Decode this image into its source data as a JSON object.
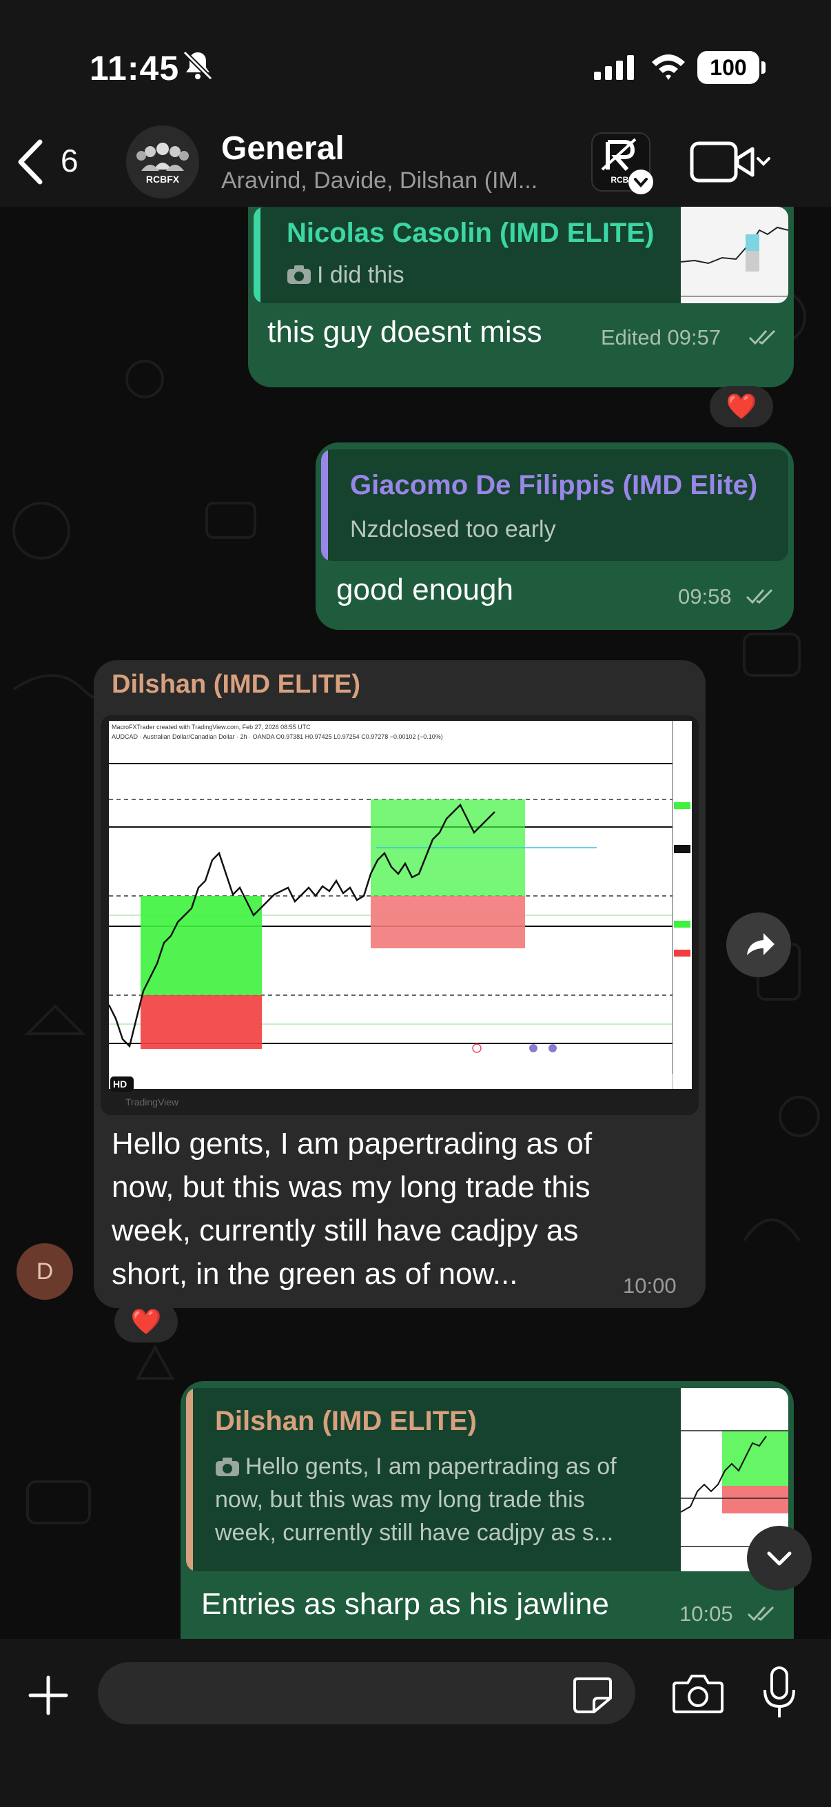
{
  "status_bar": {
    "time": "11:45",
    "battery": "100"
  },
  "header": {
    "back_count": "6",
    "group_avatar_text": "RCBFX",
    "title": "General",
    "subtitle": "Aravind, Davide, Dilshan (IM...",
    "rcbi_label": "RCBI"
  },
  "messages": [
    {
      "quote_name": "Nicolas Casolin (IMD ELITE)",
      "quote_text": "I did this",
      "text": "this guy doesnt miss",
      "meta": "Edited 09:57",
      "reaction": "❤️"
    },
    {
      "quote_name": "Giacomo De Filippis (IMD Elite)",
      "quote_text": "Nzdclosed too early",
      "text": "good enough",
      "meta": "09:58"
    },
    {
      "sender": "Dilshan (IMD ELITE)",
      "image_header": "MacroFXTrader created with TradingView.com, Feb 27, 2026 08:55 UTC",
      "image_symbol": "AUDCAD · Australian Dollar/Canadian Dollar · 2h · OANDA  O0.97381 H0.97425 L0.97254 C0.97278 −0.00102 (−0.10%)",
      "image_hd": "HD",
      "image_brand": "TradingView",
      "text_lines": [
        "Hello gents, I am papertrading as of",
        "now, but this was my long trade this",
        "week, currently still have cadjpy as",
        "short, in the green as of now..."
      ],
      "meta": "10:00",
      "avatar_letter": "D",
      "reaction": "❤️"
    },
    {
      "quote_name": "Dilshan (IMD ELITE)",
      "quote_lines": [
        "Hello gents, I am papertrading as of",
        "now, but this was my long trade this",
        "week, currently still have cadjpy as s..."
      ],
      "text": "Entries as sharp as his jawline",
      "meta": "10:05"
    }
  ],
  "composer": {
    "placeholder": ""
  },
  "colors": {
    "outgoing_bubble": "#1f5c3e",
    "incoming_bubble": "#2a2a2a",
    "quote_green": "#3dd6a5",
    "quote_purple": "#9a86e8",
    "quote_orange": "#d8a07e"
  }
}
